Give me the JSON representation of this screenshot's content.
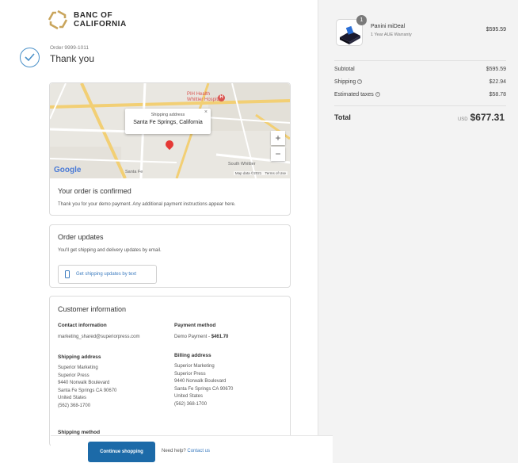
{
  "brand": {
    "line1": "BANC OF",
    "line2": "CALIFORNIA",
    "logo_color": "#c9a55c"
  },
  "order": {
    "number": "Order 9999-1011",
    "thanks": "Thank you"
  },
  "map": {
    "popup_title": "Shipping address",
    "popup_location": "Santa Fe Springs, California",
    "place_labels": [
      "PIH Health",
      "Whittier Hospital",
      "Santa Fe",
      "South Whittier"
    ],
    "google": "Google",
    "map_data": "Map data ©2021",
    "terms": "Terms of Use",
    "zoom_in": "+",
    "zoom_out": "−",
    "close": "×"
  },
  "confirmed": {
    "title": "Your order is confirmed",
    "text": "Thank you for your demo payment. Any additional payment instructions appear here."
  },
  "updates": {
    "title": "Order updates",
    "text": "You'll get shipping and delivery updates by email.",
    "button": "Get shipping updates by text"
  },
  "customer": {
    "title": "Customer information",
    "contact_label": "Contact information",
    "contact_value": "marketing_shared@superiorpress.com",
    "payment_label": "Payment method",
    "payment_value": "Demo Payment - ",
    "payment_amount": "$461.70",
    "shipping_label": "Shipping address",
    "shipping_lines": [
      "Superior Marketing",
      "Superior Press",
      "9440 Norwalk Boulevard",
      "Santa Fe Springs CA 90670",
      "United States",
      "(562) 368-1700"
    ],
    "billing_label": "Billing address",
    "billing_lines": [
      "Superior Marketing",
      "Superior Press",
      "9440 Norwalk Boulevard",
      "Santa Fe Springs CA 90670",
      "United States",
      "(562) 368-1700"
    ],
    "shipping_method_label": "Shipping method"
  },
  "summary": {
    "product_name": "Panini miDeal",
    "product_sub": "1 Year AUE Warranty",
    "product_price": "$595.59",
    "qty": "1",
    "subtotal_label": "Subtotal",
    "subtotal": "$595.59",
    "shipping_label": "Shipping",
    "shipping": "$22.94",
    "taxes_label": "Estimated taxes",
    "taxes": "$58.78",
    "total_label": "Total",
    "currency": "USD",
    "total": "$677.31"
  },
  "footer": {
    "continue": "Continue shopping",
    "help": "Need help?",
    "contact": "Contact us"
  }
}
